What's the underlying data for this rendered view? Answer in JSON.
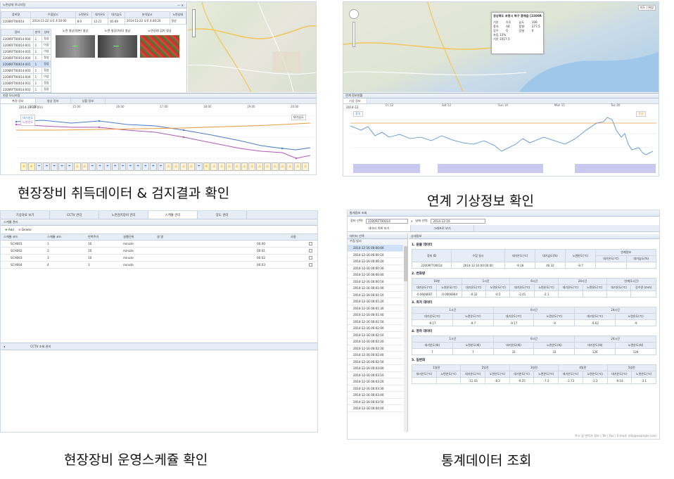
{
  "captions": {
    "p1": "현장장비 취득데이터 & 검지결과 확인",
    "p2": "연계 기상정보 확인",
    "p3": "현장장비 운영스케쥴 확인",
    "p4": "통계데이터 조회"
  },
  "p1": {
    "window_title": "노면상태 모니터링",
    "top_headers": [
      "장비명",
      "수집일시",
      "노면온도",
      "대기온도",
      "대기습도",
      "분석일시",
      "노면상태"
    ],
    "top_values": [
      "2200RFT00014",
      "2014-11-22 오후 4:10:00",
      "8.9",
      "12.21",
      "65.69",
      "2014-11-22 오후 4:40:20",
      "정상"
    ],
    "list_headers": [
      "장비",
      "분석",
      "상태"
    ],
    "list_rows": [
      [
        "2200RFT00014-004",
        "1",
        "정상"
      ],
      [
        "2200RFT00014-001",
        "1",
        "이상"
      ],
      [
        "2200RFT00014-003",
        "1",
        "이상"
      ],
      [
        "2200RFT00014-004",
        "1",
        "정상"
      ],
      [
        "2200RFT00014-001",
        "1",
        "정상"
      ],
      [
        "2200RFT00014-003",
        "1",
        "정상"
      ],
      [
        "2200RFT00014-004",
        "1",
        "이상"
      ],
      [
        "2200RFT00014-001",
        "1",
        "정상"
      ],
      [
        "2200RFT00014-003",
        "1",
        "정상"
      ]
    ],
    "image_titles": [
      "노면 영상(원본) 영상",
      "노면 영상(처리) 영상",
      "노면상태 검지 영상"
    ],
    "chart_panel_title": "현장 모니터링",
    "chart_tabs": [
      "측정 정보",
      "영상 정보",
      "상황 정보"
    ],
    "chart_date": "2014-11-22 (Fri)",
    "time_ticks": [
      "14:00",
      "15:00",
      "16:00",
      "17:00",
      "18:00",
      "19:00",
      "20:00"
    ],
    "legend": [
      "대기온도",
      "노면온도"
    ],
    "right_legend": "대기습도"
  },
  "p2": {
    "popup_title": "경상북도 포항시 북구 흥해읍 [2200RFT]",
    "popup_rows": [
      [
        "기온",
        "4.6",
        "습도",
        "106"
      ],
      [
        "풍속",
        "44",
        "풍향",
        "277.5"
      ],
      [
        "강수",
        "0",
        "강설",
        "0"
      ]
    ],
    "popup_extra": [
      "자동 12%",
      "기온 1017.5"
    ],
    "map_zoom": "지도 | 위성",
    "panel_title": "연계 정보현황",
    "tab": "기상 정보",
    "date_label": "2014-12",
    "x_ticks": [
      "Fri 12",
      "Sat 13",
      "Sun 14",
      "Mon 15",
      "Tue 16"
    ],
    "legend_left": "풍속",
    "legend_right": "풍향"
  },
  "p3": {
    "tabs": [
      "기상자료 보기",
      "CCTV 관리",
      "노면검지장비 관리",
      "스케쥴 관리",
      "장도 관리"
    ],
    "active_tab": 3,
    "section_title": "스케쥴 관리",
    "add_label": "Add",
    "delete_label": "Delete",
    "col_headers": [
      "스케쥴 코드",
      "스케쥴 코드",
      "반복주기",
      "실행단위",
      "설 명",
      "",
      "",
      "사용"
    ],
    "rows": [
      [
        "SCH001",
        "1",
        "10",
        "minute",
        "",
        "00:00"
      ],
      [
        "SCH002",
        "2",
        "10",
        "minute",
        "",
        "00:01"
      ],
      [
        "SCH003",
        "3",
        "10",
        "minute",
        "",
        "00:02"
      ],
      [
        "SCH004",
        "4",
        "3",
        "minute",
        "",
        "00:03"
      ]
    ],
    "bottom_tab": "CCTV 조회 관리"
  },
  "p4": {
    "window_title": "통계정보 조회",
    "equip_label": "장비 선택:",
    "equip_value": "2200RFT00014",
    "date_label": "날짜 선택:",
    "date_value": "2014-12-16",
    "tabs": [
      "데이터 목록 보기",
      "그래프로 보기"
    ],
    "left_header": "데이터 선택",
    "left_sub": "수집 일시",
    "right_header": "상세정보",
    "times": [
      "2014-12-16 00:00:00",
      "2014-12-16 00:00:10",
      "2014-12-16 00:00:20",
      "2014-12-16 00:00:30",
      "2014-12-16 00:00:40",
      "2014-12-16 00:00:50",
      "2014-12-16 00:01:00",
      "2014-12-16 00:01:10",
      "2014-12-16 00:01:20",
      "2014-12-16 00:01:30",
      "2014-12-16 00:01:40",
      "2014-12-16 00:01:50",
      "2014-12-16 00:02:00",
      "2014-12-16 00:02:10",
      "2014-12-16 00:02:20",
      "2014-12-16 00:02:30",
      "2014-12-16 00:02:40",
      "2014-12-16 00:02:50",
      "2014-12-16 00:03:00",
      "2014-12-16 00:03:10",
      "2014-12-16 00:03:20",
      "2014-12-16 00:03:30",
      "2014-12-16 00:03:40",
      "2014-12-16 00:03:50",
      "2014-12-16 00:04:00"
    ],
    "s1_title": "1. 원물 데이터",
    "s1_headers": [
      "장비 ID",
      "수집 일시",
      "대기온도(℃)",
      "대기습도(%)",
      "노면온도(℃)",
      "연계정보"
    ],
    "s1_sub": [
      "대기온도(℃)",
      "대기습도(%)"
    ],
    "s1_row": [
      "2200RFT00014",
      "2014-12-16 00:00:00",
      "-9.18",
      "40.32",
      "-9.7",
      "",
      ""
    ],
    "s2_title": "2. 변화량",
    "s2_groups": [
      "10분",
      "1시간",
      "6시간",
      "24시간",
      "연계(1시간)"
    ],
    "s2_sub": [
      "대기온도(℃)",
      "노면온도(℃)",
      "대기온도(℃)",
      "노면온도(℃)",
      "대기온도(℃)",
      "노면온도(℃)",
      "대기온도(℃)",
      "노면온도(℃)",
      "대기온도(℃)",
      "강수량 (mm)"
    ],
    "s2_row": [
      "-0.0666667",
      "-0.0666664",
      "-0.32",
      "-0.5",
      "-2.41",
      "-2.1",
      "",
      "",
      "",
      ""
    ],
    "s3_title": "3. 최저 데이터",
    "s3_groups": [
      "1시간",
      "6시간",
      "24시간"
    ],
    "s3_sub": [
      "대기온도(℃)",
      "노면온도(℃)",
      "대기온도(℃)",
      "노면온도(℃)",
      "대기온도(℃)",
      "노면온도(℃)"
    ],
    "s3_row": [
      "-9.17",
      "-9.7",
      "-9.17",
      "-9",
      "-9.62",
      "-9"
    ],
    "s4_title": "4. 영하 데이터",
    "s4_groups": [
      "1시간",
      "6시간",
      "24시간"
    ],
    "s4_sub": [
      "대기온도(회)",
      "노면온도(회)",
      "대기온도(회)",
      "노면온도(회)",
      "대기온도(회)",
      "노면온도(회)"
    ],
    "s4_row": [
      "7",
      "7",
      "33",
      "33",
      "126",
      "126"
    ],
    "s5_title": "5. 일변화",
    "s5_groups": [
      "1일전",
      "2일전",
      "3일전",
      "4일전",
      "5일전"
    ],
    "s5_sub": [
      "대기온도(℃)",
      "노면온도(℃)",
      "대기온도(℃)",
      "노면온도(℃)",
      "대기온도(℃)",
      "노면온도(℃)",
      "대기온도(℃)",
      "노면온도(℃)",
      "대기온도(℃)",
      "노면온도(℃)"
    ],
    "s5_row": [
      "",
      "",
      "-11.43",
      "-8.2",
      "-9.25",
      "-7.3",
      "-2.73",
      "-2.2",
      "-9.14",
      "-3.1"
    ],
    "footer": "주소 및 연락처 정보 | Tel / Fax | E-mail: info@example.com"
  }
}
